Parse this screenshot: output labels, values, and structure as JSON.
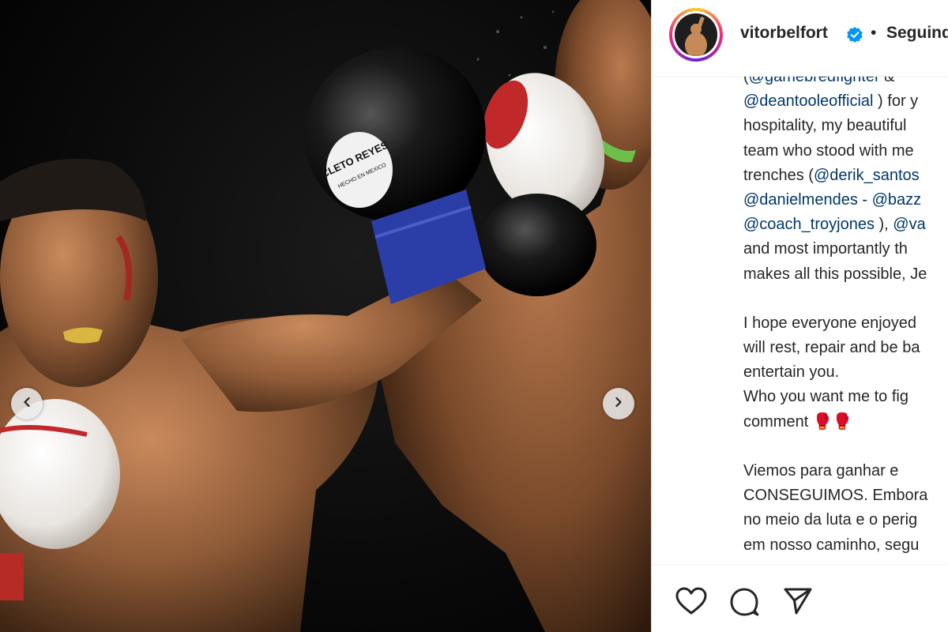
{
  "post": {
    "username": "vitorbelfort",
    "separator": "•",
    "follow_label": "Seguindo"
  },
  "caption_lines": [
    {
      "parts": [
        {
          "t": "(",
          "m": false
        },
        {
          "t": "@gamebredfighter",
          "m": true
        },
        {
          "t": " &",
          "m": false
        }
      ]
    },
    {
      "parts": [
        {
          "t": "@deantooleofficial",
          "m": true
        },
        {
          "t": " ) for y",
          "m": false
        }
      ]
    },
    {
      "parts": [
        {
          "t": "hospitality, my beautiful",
          "m": false
        }
      ]
    },
    {
      "parts": [
        {
          "t": "team who stood with me",
          "m": false
        }
      ]
    },
    {
      "parts": [
        {
          "t": "trenches (",
          "m": false
        },
        {
          "t": "@derik_santos",
          "m": true
        }
      ]
    },
    {
      "parts": [
        {
          "t": "@danielmendes",
          "m": true
        },
        {
          "t": " - ",
          "m": false
        },
        {
          "t": "@bazz",
          "m": true
        }
      ]
    },
    {
      "parts": [
        {
          "t": "@coach_troyjones",
          "m": true
        },
        {
          "t": " ), ",
          "m": false
        },
        {
          "t": "@va",
          "m": true
        }
      ]
    },
    {
      "parts": [
        {
          "t": "and most importantly th",
          "m": false
        }
      ]
    },
    {
      "parts": [
        {
          "t": "makes all this possible, Je",
          "m": false
        }
      ]
    },
    {
      "gap": true
    },
    {
      "parts": [
        {
          "t": "I hope everyone enjoyed",
          "m": false
        }
      ]
    },
    {
      "parts": [
        {
          "t": "will rest, repair and be ba",
          "m": false
        }
      ]
    },
    {
      "parts": [
        {
          "t": "entertain you.",
          "m": false
        }
      ]
    },
    {
      "parts": [
        {
          "t": "Who you want me to fig",
          "m": false
        }
      ]
    },
    {
      "parts": [
        {
          "t": "comment 🥊🥊",
          "m": false
        }
      ]
    },
    {
      "gap": true
    },
    {
      "parts": [
        {
          "t": "Viemos para ganhar e",
          "m": false
        }
      ]
    },
    {
      "parts": [
        {
          "t": "CONSEGUIMOS. Embora",
          "m": false
        }
      ]
    },
    {
      "parts": [
        {
          "t": "no meio da luta e o perig",
          "m": false
        }
      ]
    },
    {
      "parts": [
        {
          "t": "em nosso caminho, segu",
          "m": false
        }
      ]
    }
  ],
  "glove_brand": "CLETO REYES",
  "glove_sub": "HECHO EN MEXICO",
  "colors": {
    "mention": "#00376b",
    "text": "#262626",
    "verified": "#0095f6"
  },
  "icons": {
    "prev": "chevron-left-icon",
    "next": "chevron-right-icon",
    "like": "heart-icon",
    "comment": "comment-icon",
    "share": "paper-plane-icon",
    "verified": "verified-badge-icon"
  }
}
